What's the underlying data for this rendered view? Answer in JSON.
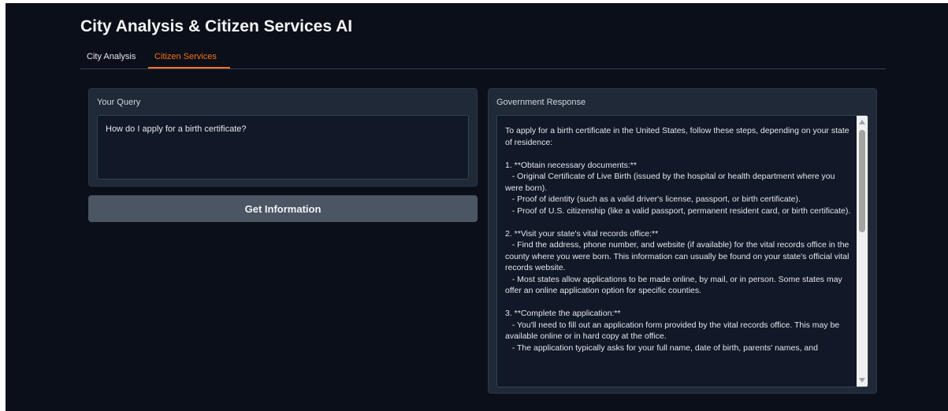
{
  "app": {
    "title": "City Analysis & Citizen Services AI"
  },
  "tabs": [
    {
      "label": "City Analysis",
      "active": false
    },
    {
      "label": "Citizen Services",
      "active": true
    }
  ],
  "query": {
    "label": "Your Query",
    "value": "How do I apply for a birth certificate?"
  },
  "button": {
    "label": "Get Information"
  },
  "response": {
    "label": "Government Response",
    "text": "To apply for a birth certificate in the United States, follow these steps, depending on your state of residence:\n\n1. **Obtain necessary documents:**\n   - Original Certificate of Live Birth (issued by the hospital or health department where you were born).\n   - Proof of identity (such as a valid driver's license, passport, or birth certificate).\n   - Proof of U.S. citizenship (like a valid passport, permanent resident card, or birth certificate).\n\n2. **Visit your state's vital records office:**\n   - Find the address, phone number, and website (if available) for the vital records office in the county where you were born. This information can usually be found on your state's official vital records website.\n   - Most states allow applications to be made online, by mail, or in person. Some states may offer an online application option for specific counties.\n\n3. **Complete the application:**\n   - You'll need to fill out an application form provided by the vital records office. This may be available online or in hard copy at the office.\n   - The application typically asks for your full name, date of birth, parents' names, and"
  },
  "colors": {
    "background": "#0b0f19",
    "panel": "#1f2937",
    "accent": "#f97316",
    "button": "#4b5563"
  }
}
